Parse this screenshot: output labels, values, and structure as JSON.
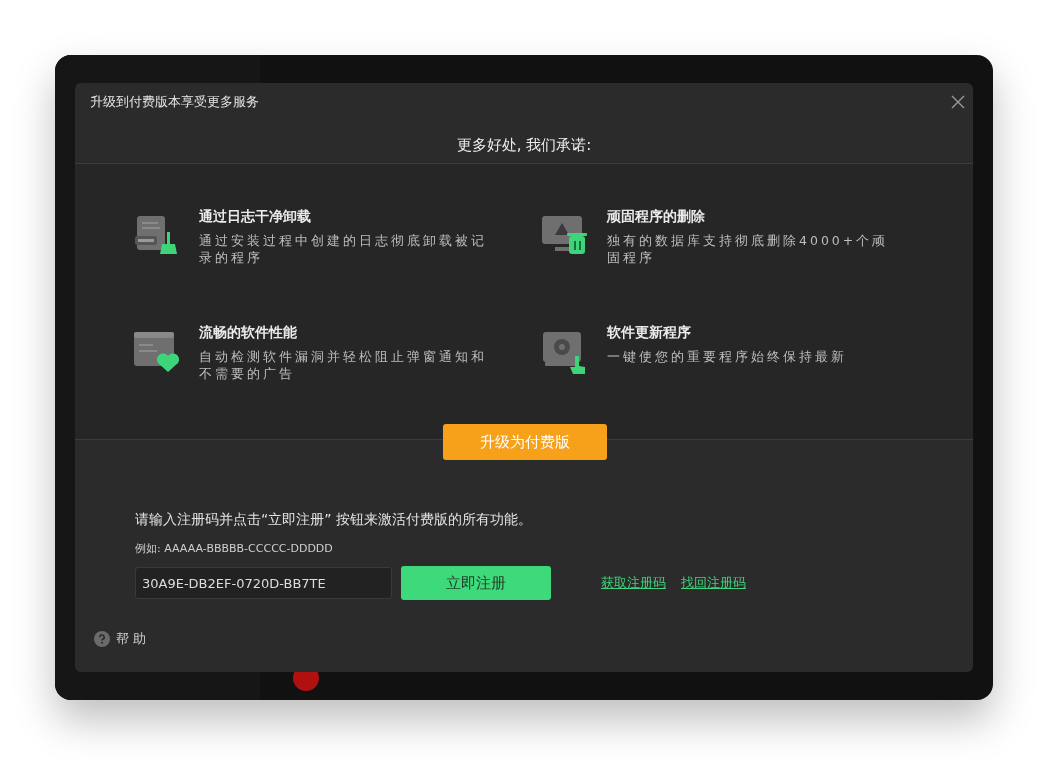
{
  "dialog": {
    "title": "升级到付费版本享受更多服务",
    "subtitle": "更多好处, 我们承诺:"
  },
  "features": [
    {
      "kind": "log",
      "title": "通过日志干净卸载",
      "description": "通过安装过程中创建的日志彻底卸载被记录的程序"
    },
    {
      "kind": "stubborn",
      "title": "顽固程序的删除",
      "description": "独有的数据库支持彻底删除4000+个顽固程序"
    },
    {
      "kind": "performance",
      "title": "流畅的软件性能",
      "description": "自动检测软件漏洞并轻松阻止弹窗通知和不需要的广告"
    },
    {
      "kind": "update",
      "title": "软件更新程序",
      "description": "一键使您的重要程序始终保持最新"
    }
  ],
  "upgrade_button": "升级为付费版",
  "registration": {
    "instruction": "请输入注册码并点击“立即注册” 按钮来激活付费版的所有功能。",
    "example": "例如: AAAAA-BBBBB-CCCCC-DDDDD",
    "code_value": "30A9E-DB2EF-0720D-BB7TE",
    "register_button": "立即注册",
    "links": [
      "获取注册码",
      "找回注册码"
    ]
  },
  "help": {
    "label": "帮 助"
  }
}
